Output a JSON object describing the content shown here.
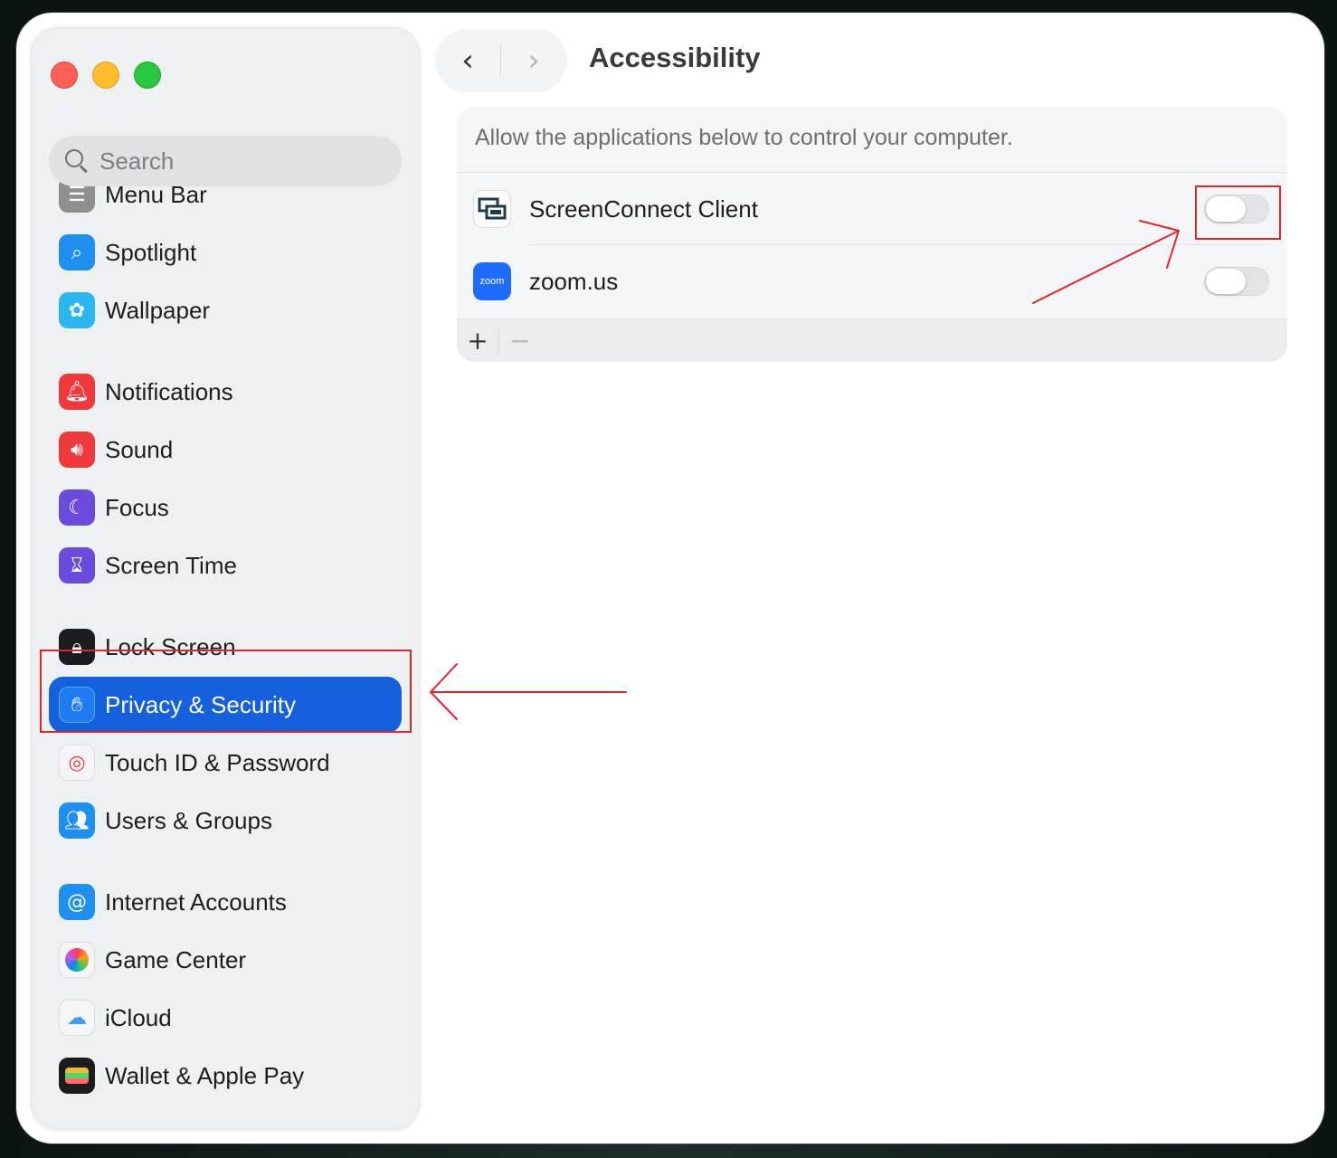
{
  "window": {
    "title": "Accessibility",
    "back_glyph": "‹",
    "forward_glyph": "›"
  },
  "search": {
    "placeholder": "Search"
  },
  "sidebar": {
    "items": [
      {
        "label": "Menu Bar",
        "icon": "menu-bar-icon",
        "color": "#8e8e93"
      },
      {
        "label": "Spotlight",
        "icon": "magnifier-icon",
        "color": "#1f8ef1"
      },
      {
        "label": "Wallpaper",
        "icon": "flower-icon",
        "color": "#2ab6f0"
      },
      {
        "label": "Notifications",
        "icon": "bell-icon",
        "color": "#f0393d"
      },
      {
        "label": "Sound",
        "icon": "speaker-icon",
        "color": "#f0393d"
      },
      {
        "label": "Focus",
        "icon": "moon-icon",
        "color": "#6a4bdc"
      },
      {
        "label": "Screen Time",
        "icon": "hourglass-icon",
        "color": "#6a4bdc"
      },
      {
        "label": "Lock Screen",
        "icon": "lock-icon",
        "color": "#1c1c1e"
      },
      {
        "label": "Privacy & Security",
        "icon": "hand-icon",
        "color": "#1f7cf0",
        "selected": true
      },
      {
        "label": "Touch ID & Password",
        "icon": "fingerprint-icon",
        "color": "#f5f5f7"
      },
      {
        "label": "Users & Groups",
        "icon": "users-icon",
        "color": "#1f8ef1"
      },
      {
        "label": "Internet Accounts",
        "icon": "at-icon",
        "color": "#1f8ef1"
      },
      {
        "label": "Game Center",
        "icon": "game-center-icon",
        "color": "#f5f5f7"
      },
      {
        "label": "iCloud",
        "icon": "cloud-icon",
        "color": "#f5f5f7"
      },
      {
        "label": "Wallet & Apple Pay",
        "icon": "wallet-icon",
        "color": "#1c1c1e"
      }
    ]
  },
  "panel": {
    "description": "Allow the applications below to control your computer.",
    "apps": [
      {
        "name": "ScreenConnect Client",
        "icon": "screenconnect-icon",
        "enabled": false
      },
      {
        "name": "zoom.us",
        "icon": "zoom-icon",
        "icon_text": "zoom",
        "enabled": false
      }
    ],
    "add_label": "+",
    "remove_label": "−"
  },
  "annotations": {
    "color": "#e0262d"
  }
}
